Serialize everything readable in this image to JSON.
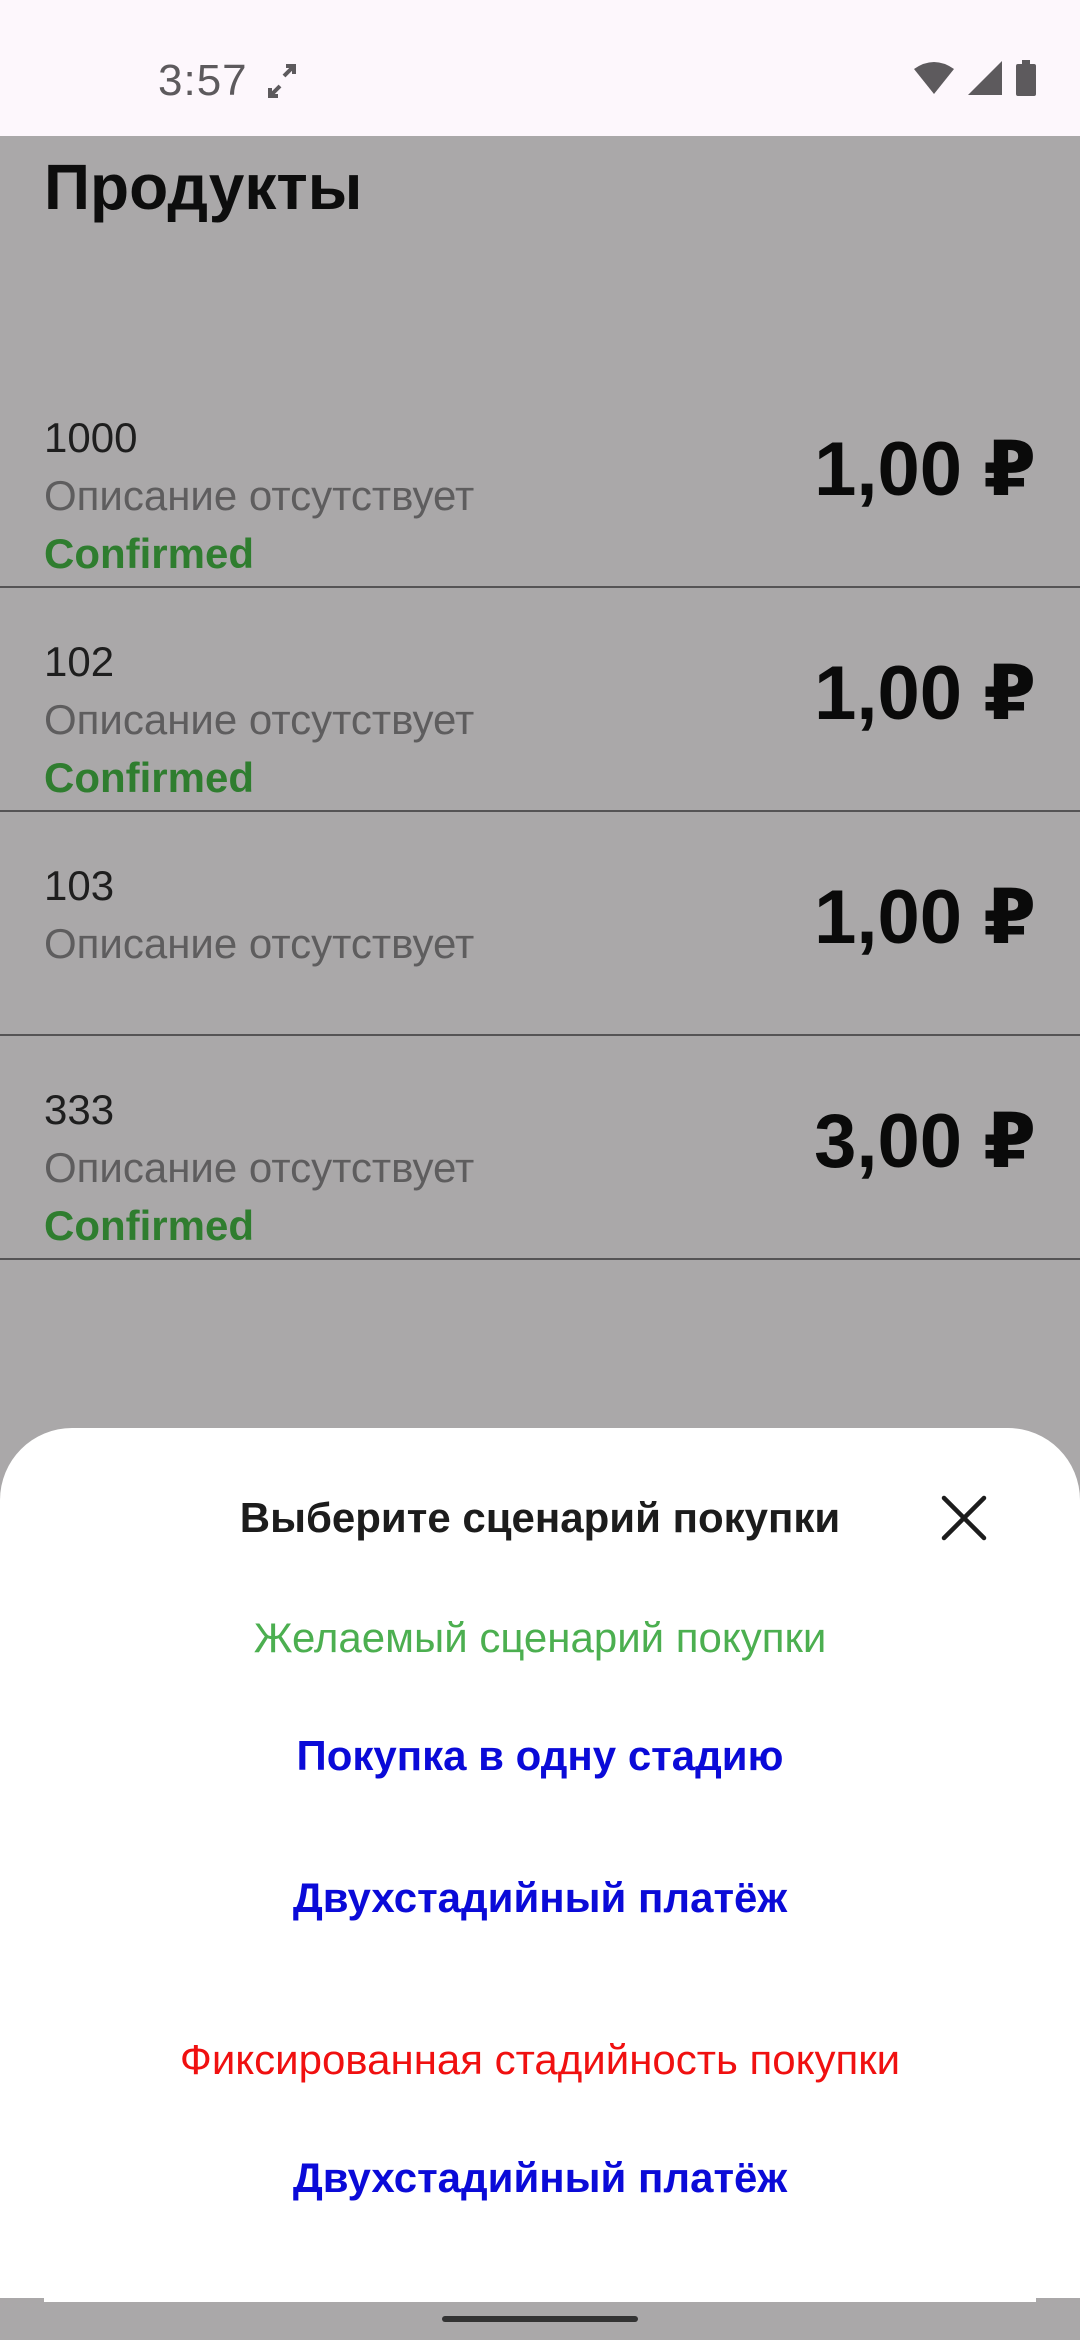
{
  "status_bar": {
    "time": "3:57",
    "icons": [
      "sync-icon",
      "wifi-icon",
      "cell-signal-icon",
      "battery-icon"
    ]
  },
  "page": {
    "title": "Продукты"
  },
  "products": [
    {
      "name": "1000",
      "description": "Описание отсутствует",
      "status": "Confirmed",
      "price": "1,00 ₽"
    },
    {
      "name": "102",
      "description": "Описание отсутствует",
      "status": "Confirmed",
      "price": "1,00 ₽"
    },
    {
      "name": "103",
      "description": "Описание отсутствует",
      "status": "",
      "price": "1,00 ₽"
    },
    {
      "name": "333",
      "description": "Описание отсутствует",
      "status": "Confirmed",
      "price": "3,00 ₽"
    }
  ],
  "sheet": {
    "title": "Выберите сценарий покупки",
    "desired_label": "Желаемый сценарий покупки",
    "one_stage_button": "Покупка в одну стадию",
    "two_stage_button": "Двухстадийный платёж",
    "fixed_label": "Фиксированная стадийность покупки",
    "fixed_two_stage_button": "Двухстадийный платёж"
  },
  "colors": {
    "status_confirmed": "#2f7d2f",
    "green_label": "#4caf50",
    "red_label": "#f01010",
    "link_blue": "#0a0ad8",
    "scrim": "#aaa8a9"
  }
}
